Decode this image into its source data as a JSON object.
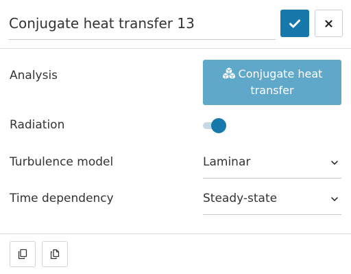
{
  "header": {
    "title_value": "Conjugate heat transfer 13",
    "confirm_icon": "check-icon",
    "close_icon": "close-icon"
  },
  "colors": {
    "accent": "#1779ab",
    "analysis_button": "#5fa8c9"
  },
  "rows": {
    "analysis": {
      "label": "Analysis",
      "button_icon": "cubes-icon",
      "button_label": "Conjugate heat transfer"
    },
    "radiation": {
      "label": "Radiation",
      "toggle_on": true
    },
    "turbulence": {
      "label": "Turbulence model",
      "selected": "Laminar"
    },
    "time": {
      "label": "Time dependency",
      "selected": "Steady-state"
    }
  },
  "footer": {
    "buttons": [
      {
        "icon": "copy-icon"
      },
      {
        "icon": "duplicate-icon"
      }
    ]
  }
}
